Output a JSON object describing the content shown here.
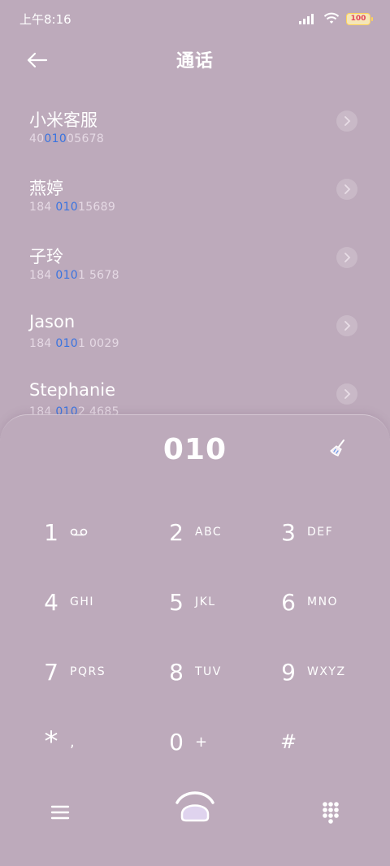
{
  "status_bar": {
    "time": "上午8:16",
    "battery": "100"
  },
  "header": {
    "title": "通话"
  },
  "contacts": [
    {
      "name": "小米客服",
      "num_pre": "40",
      "num_hl": "010",
      "num_post": "05678"
    },
    {
      "name": "燕婷",
      "num_pre": "184 ",
      "num_hl": "010",
      "num_post": "15689"
    },
    {
      "name": "子玲",
      "num_pre": "184 ",
      "num_hl": "010",
      "num_post": "1 5678"
    },
    {
      "name": "Jason",
      "num_pre": "184 ",
      "num_hl": "010",
      "num_post": "1 0029"
    },
    {
      "name": "Stephanie",
      "num_pre": "184 ",
      "num_hl": "010",
      "num_post": "2 4685"
    }
  ],
  "dialpad": {
    "entered": "010",
    "keys": [
      {
        "digit": "1",
        "letters": ""
      },
      {
        "digit": "2",
        "letters": "ABC"
      },
      {
        "digit": "3",
        "letters": "DEF"
      },
      {
        "digit": "4",
        "letters": "GHI"
      },
      {
        "digit": "5",
        "letters": "JKL"
      },
      {
        "digit": "6",
        "letters": "MNO"
      },
      {
        "digit": "7",
        "letters": "PQRS"
      },
      {
        "digit": "8",
        "letters": "TUV"
      },
      {
        "digit": "9",
        "letters": "WXYZ"
      },
      {
        "digit": "*",
        "letters": ","
      },
      {
        "digit": "0",
        "letters": "+"
      },
      {
        "digit": "#",
        "letters": ""
      }
    ]
  },
  "icons": {
    "back": "arrow-left-icon",
    "clear": "broom-icon",
    "voicemail": "voicemail-icon",
    "menu": "menu-icon",
    "call": "call-icon",
    "dialpad": "dialpad-icon"
  },
  "colors": {
    "background": "#bdaabb",
    "highlight": "#3a74e0"
  }
}
